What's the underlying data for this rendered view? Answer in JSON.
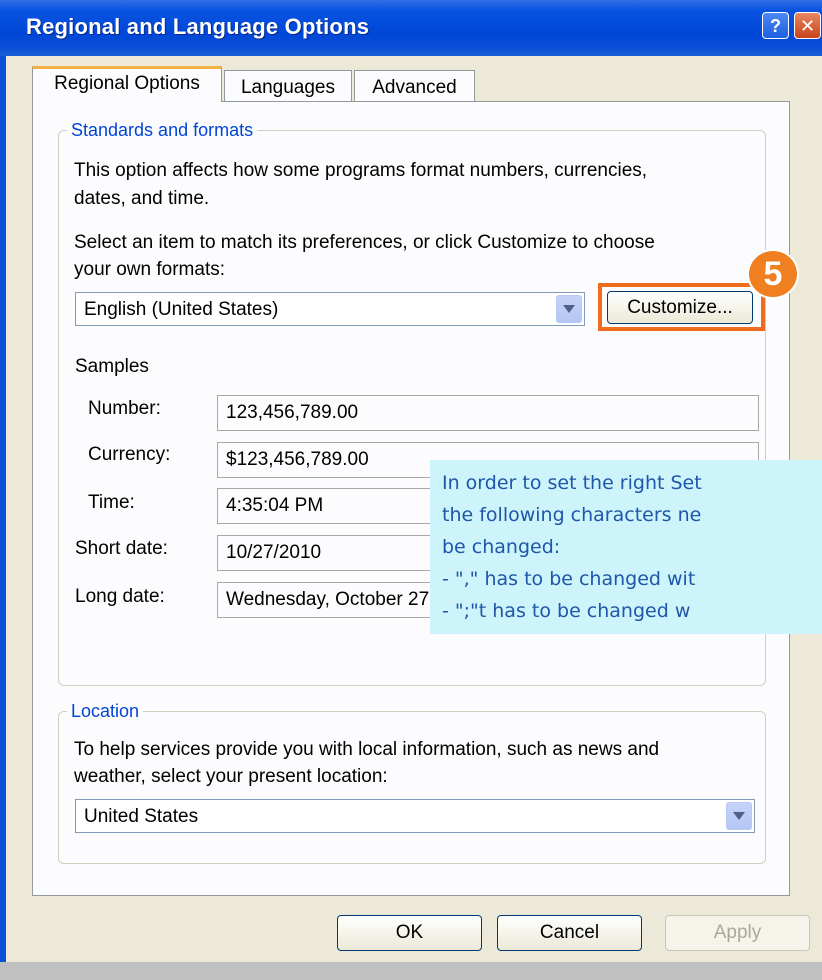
{
  "window": {
    "title": "Regional and Language Options",
    "help_glyph": "?",
    "close_glyph": "✕"
  },
  "tabs": [
    {
      "label": "Regional Options",
      "active": true
    },
    {
      "label": "Languages",
      "active": false
    },
    {
      "label": "Advanced",
      "active": false
    }
  ],
  "standards": {
    "legend": "Standards and formats",
    "description_line1": "This option affects how some programs format numbers, currencies,",
    "description_line2": "dates, and time.",
    "instruction_line1": "Select an item to match its preferences, or click Customize to choose",
    "instruction_line2": "your own formats:",
    "format_value": "English (United States)",
    "customize_label": "Customize...",
    "samples_label": "Samples",
    "samples": [
      {
        "label": "Number:",
        "value": "123,456,789.00"
      },
      {
        "label": "Currency:",
        "value": "$123,456,789.00"
      },
      {
        "label": "Time:",
        "value": "4:35:04 PM"
      },
      {
        "label": "Short date:",
        "value": "10/27/2010"
      },
      {
        "label": "Long date:",
        "value": "Wednesday, October 27, 2010"
      }
    ]
  },
  "location": {
    "legend": "Location",
    "description_line1": "To help services provide you with local information, such as news and",
    "description_line2": "weather, select your present location:",
    "value": "United States"
  },
  "buttons": {
    "ok": "OK",
    "cancel": "Cancel",
    "apply": "Apply"
  },
  "annotation": {
    "step_number": "5",
    "callout_lines": [
      "In order to set the right Set",
      "the following characters ne",
      "be changed:",
      "- \",\" has to be changed wit",
      "- \";\"t has to be changed w"
    ]
  },
  "colors": {
    "accent": "#0a4fd6",
    "highlight": "#ef6c1c",
    "callout_bg": "#cdf4fb",
    "callout_text": "#1f56a8"
  }
}
